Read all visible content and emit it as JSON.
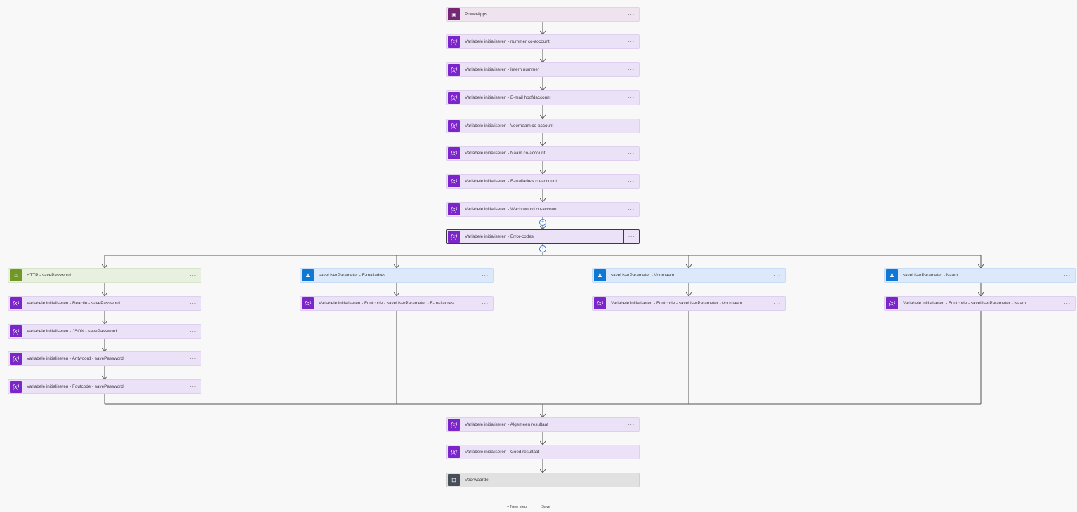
{
  "trigger": {
    "label": "PowerApps",
    "icon": "powerapps-icon"
  },
  "main_steps": [
    {
      "label": "Variabele initialiseren - nummer co-account",
      "icon": "variable-icon"
    },
    {
      "label": "Variabele initialiseren - Intern nummer",
      "icon": "variable-icon"
    },
    {
      "label": "Variabele initialiseren - E-mail hoofdaccount",
      "icon": "variable-icon"
    },
    {
      "label": "Variabele initialiseren - Voornaam co-account",
      "icon": "variable-icon"
    },
    {
      "label": "Variabele initialiseren - Naam co-account",
      "icon": "variable-icon"
    },
    {
      "label": "Variabele initialiseren - E-mailadres co-account",
      "icon": "variable-icon"
    },
    {
      "label": "Variabele initialiseren - Wachtwoord co-account",
      "icon": "variable-icon"
    },
    {
      "label": "Variabele initialiseren - Error-codes",
      "icon": "variable-icon",
      "selected": true
    }
  ],
  "branches": [
    {
      "head": {
        "label": "HTTP - savePassword",
        "icon": "http-icon"
      },
      "steps": [
        "Variabele initialiseren - Reactie - savePassword",
        "Variabele initialiseren - JSON - savePassword",
        "Variabele initialiseren - Antwoord - savePassword",
        "Variabele initialiseren - Foutcode - savePassword"
      ]
    },
    {
      "head": {
        "label": "saveUserParameter - E-mailadres",
        "icon": "user-icon"
      },
      "steps": [
        "Variabele initialiseren - Foutcode - saveUserParameter - E-mailadres"
      ]
    },
    {
      "head": {
        "label": "saveUserParameter - Voornaam",
        "icon": "user-icon"
      },
      "steps": [
        "Variabele initialiseren - Foutcode - saveUserParameter - Voornaam"
      ]
    },
    {
      "head": {
        "label": "saveUserParameter - Naam",
        "icon": "user-icon"
      },
      "steps": [
        "Variabele initialiseren - Foutcode - saveUserParameter - Naam"
      ]
    }
  ],
  "after_steps": [
    {
      "label": "Variabele initialiseren - Algemeen resultaat",
      "icon": "variable-icon"
    },
    {
      "label": "Variabele initialiseren - Goed resultaat",
      "icon": "variable-icon"
    }
  ],
  "condition": {
    "label": "Voorwaarde",
    "icon": "condition-icon"
  },
  "more_label": "···",
  "variable_glyph": "{x}",
  "bottom": {
    "new_step": "+ New step",
    "save": "Save"
  }
}
